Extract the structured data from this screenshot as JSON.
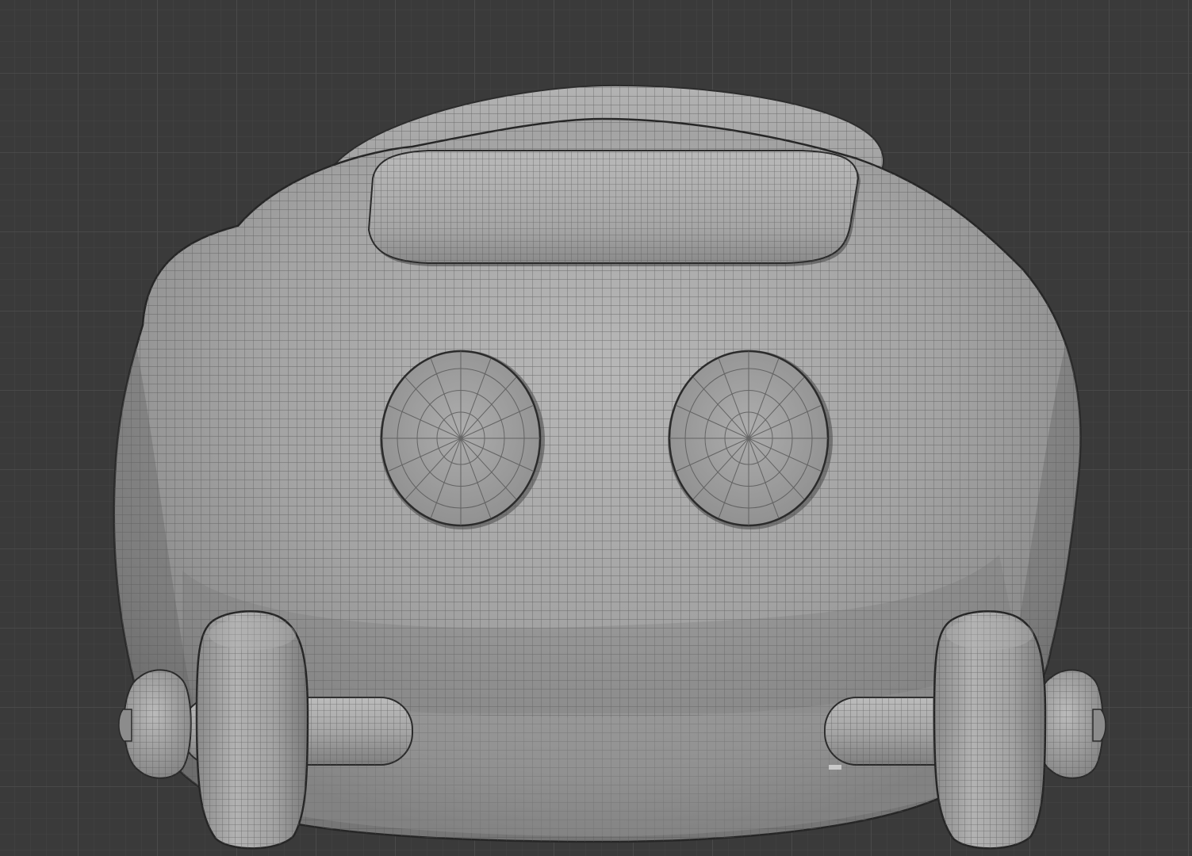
{
  "viewport": {
    "view": "front-orthographic",
    "shading": "solid",
    "wireframe_overlay": true
  },
  "scene": {
    "object": "toy-car-body",
    "parts": [
      "body",
      "roof-scoop",
      "left-eye",
      "right-eye",
      "front-axle",
      "left-wheel",
      "right-wheel",
      "left-axle-cap",
      "right-axle-cap"
    ]
  },
  "colors": {
    "background": "#3a3a3a",
    "grid_minor": "#434343",
    "grid_major": "#4c4c4c",
    "mesh_base": "#9c9c9c",
    "mesh_light": "#bdbdbd",
    "mesh_dark": "#6e6e6e",
    "wire": "#5a5a5a",
    "outline": "#2a2a2a"
  }
}
